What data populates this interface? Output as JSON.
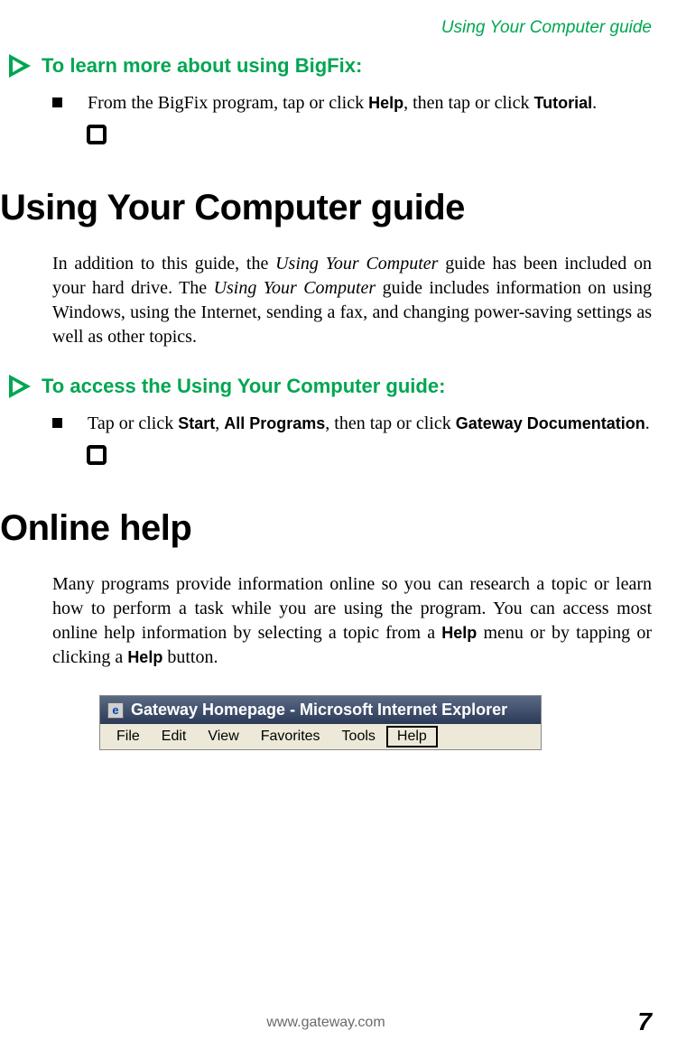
{
  "header": {
    "running_head": "Using Your Computer guide"
  },
  "section1": {
    "title": "To learn more about using BigFix:",
    "bullet": {
      "text_before": "From the BigFix program, tap or click ",
      "bold1": "Help",
      "text_mid": ", then tap or click ",
      "bold2": "Tutorial",
      "text_after": "."
    }
  },
  "section2": {
    "heading": "Using Your Computer guide",
    "para_parts": {
      "p1": "In addition to this guide, the ",
      "i1": "Using Your Computer",
      "p2": " guide has been included on your hard drive. The ",
      "i2": "Using Your Computer",
      "p3": " guide includes information on using Windows, using the Internet, sending a fax, and changing power-saving settings as well as other topics."
    },
    "procedure_title": "To access the Using Your Computer guide:",
    "bullet": {
      "text_before": "Tap or click ",
      "bold1": "Start",
      "text_mid1": ", ",
      "bold2": "All Programs",
      "text_mid2": ", then tap or click ",
      "bold3": "Gateway Documentation",
      "text_after": "."
    }
  },
  "section3": {
    "heading": "Online help",
    "para_parts": {
      "p1": "Many programs provide information online so you can research a topic or learn how to perform a task while you are using the program. You can access most online help information by selecting a topic from a ",
      "bold1": "Help",
      "p2": " menu or by tapping or clicking a ",
      "bold2": "Help",
      "p3": " button."
    }
  },
  "screenshot": {
    "title": "Gateway Homepage - Microsoft Internet Explorer",
    "menus": [
      "File",
      "Edit",
      "View",
      "Favorites",
      "Tools",
      "Help"
    ],
    "highlighted_index": 5
  },
  "footer": {
    "url": "www.gateway.com",
    "page": "7"
  }
}
